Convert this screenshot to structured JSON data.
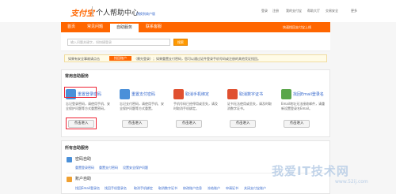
{
  "header": {
    "logo": "支付宝",
    "title": "个人帮助中心",
    "subtitle": "切换到商户版",
    "nav": [
      "登录",
      "注册",
      "我的支付宝",
      "帮助大厅",
      "交易安全",
      "更多"
    ]
  },
  "navbar": {
    "tabs": [
      "首页",
      "常见问题",
      "自助服务",
      "联系客服"
    ],
    "active_tab": "自助服务",
    "right_text": "快速找回支付宝上线"
  },
  "search": {
    "placeholder": "输入问题关键字，如快捷登录",
    "button": "搜索"
  },
  "notice": {
    "prefix": "如果有安全事故请点击",
    "badge": "找回账户",
    "suffix": "（需先登录）；如果重置支付密码，您可以通过证件登录手机号码或注册的其他凭证找回。"
  },
  "common": {
    "heading": "常用自助服务",
    "cards": [
      {
        "title": "重置登录密码",
        "desc": "忘记登录密码，请使用手机、安全保护问题等方式重置密码。",
        "button": "点击进入",
        "icon_color": "#4a90d9"
      },
      {
        "title": "重置支付密码",
        "desc": "忘记支付密码，请使用手机、安全保护问题等方式重置。",
        "button": "点击进入",
        "icon_color": "#4a90d9"
      },
      {
        "title": "取消手机绑定",
        "desc": "手机号码已经停用或丢失，请及时取消手机绑定。",
        "button": "点击进入",
        "icon_color": "#e05030"
      },
      {
        "title": "取消数字证书",
        "desc": "证书无法使用或丢失，请及时取消数字证书。",
        "button": "点击进入",
        "icon_color": "#e05030"
      },
      {
        "title": "找回Email登录名",
        "desc": "Email地址无法接收邮件，请重新设置登录名Email。",
        "button": "点击进入",
        "icon_color": "#5aa64a"
      }
    ]
  },
  "all": {
    "heading": "所有自助服务",
    "groups": [
      {
        "title": "密码自助",
        "links": [
          "重置登录密码",
          "重置支付密码",
          "设置安全保护问题"
        ],
        "icon_color": "#4a90d9"
      },
      {
        "title": "账户自助",
        "links": [
          "找回Email登录名",
          "找回手机登录名",
          "取消手机绑定",
          "取消数字证书",
          "修改账户信息",
          "冻结账户",
          "申请证书",
          "关闭支付宝账户"
        ],
        "icon_color": "#f0a030"
      }
    ]
  },
  "watermark": {
    "line1": "我爱IT技术网",
    "line2": "www.52ij.com"
  },
  "colors": {
    "brand_orange": "#ff6600",
    "link_blue": "#3366cc",
    "highlight_red": "#ee2233"
  }
}
